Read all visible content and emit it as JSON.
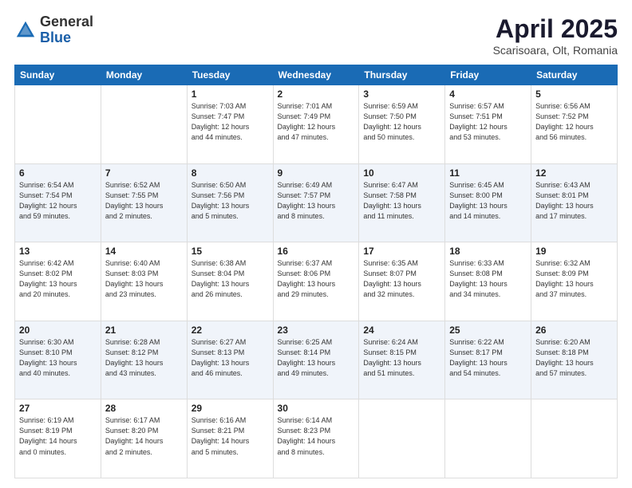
{
  "header": {
    "logo_general": "General",
    "logo_blue": "Blue",
    "month_title": "April 2025",
    "location": "Scarisoara, Olt, Romania"
  },
  "weekdays": [
    "Sunday",
    "Monday",
    "Tuesday",
    "Wednesday",
    "Thursday",
    "Friday",
    "Saturday"
  ],
  "weeks": [
    [
      {
        "day": "",
        "info": ""
      },
      {
        "day": "",
        "info": ""
      },
      {
        "day": "1",
        "info": "Sunrise: 7:03 AM\nSunset: 7:47 PM\nDaylight: 12 hours\nand 44 minutes."
      },
      {
        "day": "2",
        "info": "Sunrise: 7:01 AM\nSunset: 7:49 PM\nDaylight: 12 hours\nand 47 minutes."
      },
      {
        "day": "3",
        "info": "Sunrise: 6:59 AM\nSunset: 7:50 PM\nDaylight: 12 hours\nand 50 minutes."
      },
      {
        "day": "4",
        "info": "Sunrise: 6:57 AM\nSunset: 7:51 PM\nDaylight: 12 hours\nand 53 minutes."
      },
      {
        "day": "5",
        "info": "Sunrise: 6:56 AM\nSunset: 7:52 PM\nDaylight: 12 hours\nand 56 minutes."
      }
    ],
    [
      {
        "day": "6",
        "info": "Sunrise: 6:54 AM\nSunset: 7:54 PM\nDaylight: 12 hours\nand 59 minutes."
      },
      {
        "day": "7",
        "info": "Sunrise: 6:52 AM\nSunset: 7:55 PM\nDaylight: 13 hours\nand 2 minutes."
      },
      {
        "day": "8",
        "info": "Sunrise: 6:50 AM\nSunset: 7:56 PM\nDaylight: 13 hours\nand 5 minutes."
      },
      {
        "day": "9",
        "info": "Sunrise: 6:49 AM\nSunset: 7:57 PM\nDaylight: 13 hours\nand 8 minutes."
      },
      {
        "day": "10",
        "info": "Sunrise: 6:47 AM\nSunset: 7:58 PM\nDaylight: 13 hours\nand 11 minutes."
      },
      {
        "day": "11",
        "info": "Sunrise: 6:45 AM\nSunset: 8:00 PM\nDaylight: 13 hours\nand 14 minutes."
      },
      {
        "day": "12",
        "info": "Sunrise: 6:43 AM\nSunset: 8:01 PM\nDaylight: 13 hours\nand 17 minutes."
      }
    ],
    [
      {
        "day": "13",
        "info": "Sunrise: 6:42 AM\nSunset: 8:02 PM\nDaylight: 13 hours\nand 20 minutes."
      },
      {
        "day": "14",
        "info": "Sunrise: 6:40 AM\nSunset: 8:03 PM\nDaylight: 13 hours\nand 23 minutes."
      },
      {
        "day": "15",
        "info": "Sunrise: 6:38 AM\nSunset: 8:04 PM\nDaylight: 13 hours\nand 26 minutes."
      },
      {
        "day": "16",
        "info": "Sunrise: 6:37 AM\nSunset: 8:06 PM\nDaylight: 13 hours\nand 29 minutes."
      },
      {
        "day": "17",
        "info": "Sunrise: 6:35 AM\nSunset: 8:07 PM\nDaylight: 13 hours\nand 32 minutes."
      },
      {
        "day": "18",
        "info": "Sunrise: 6:33 AM\nSunset: 8:08 PM\nDaylight: 13 hours\nand 34 minutes."
      },
      {
        "day": "19",
        "info": "Sunrise: 6:32 AM\nSunset: 8:09 PM\nDaylight: 13 hours\nand 37 minutes."
      }
    ],
    [
      {
        "day": "20",
        "info": "Sunrise: 6:30 AM\nSunset: 8:10 PM\nDaylight: 13 hours\nand 40 minutes."
      },
      {
        "day": "21",
        "info": "Sunrise: 6:28 AM\nSunset: 8:12 PM\nDaylight: 13 hours\nand 43 minutes."
      },
      {
        "day": "22",
        "info": "Sunrise: 6:27 AM\nSunset: 8:13 PM\nDaylight: 13 hours\nand 46 minutes."
      },
      {
        "day": "23",
        "info": "Sunrise: 6:25 AM\nSunset: 8:14 PM\nDaylight: 13 hours\nand 49 minutes."
      },
      {
        "day": "24",
        "info": "Sunrise: 6:24 AM\nSunset: 8:15 PM\nDaylight: 13 hours\nand 51 minutes."
      },
      {
        "day": "25",
        "info": "Sunrise: 6:22 AM\nSunset: 8:17 PM\nDaylight: 13 hours\nand 54 minutes."
      },
      {
        "day": "26",
        "info": "Sunrise: 6:20 AM\nSunset: 8:18 PM\nDaylight: 13 hours\nand 57 minutes."
      }
    ],
    [
      {
        "day": "27",
        "info": "Sunrise: 6:19 AM\nSunset: 8:19 PM\nDaylight: 14 hours\nand 0 minutes."
      },
      {
        "day": "28",
        "info": "Sunrise: 6:17 AM\nSunset: 8:20 PM\nDaylight: 14 hours\nand 2 minutes."
      },
      {
        "day": "29",
        "info": "Sunrise: 6:16 AM\nSunset: 8:21 PM\nDaylight: 14 hours\nand 5 minutes."
      },
      {
        "day": "30",
        "info": "Sunrise: 6:14 AM\nSunset: 8:23 PM\nDaylight: 14 hours\nand 8 minutes."
      },
      {
        "day": "",
        "info": ""
      },
      {
        "day": "",
        "info": ""
      },
      {
        "day": "",
        "info": ""
      }
    ]
  ]
}
